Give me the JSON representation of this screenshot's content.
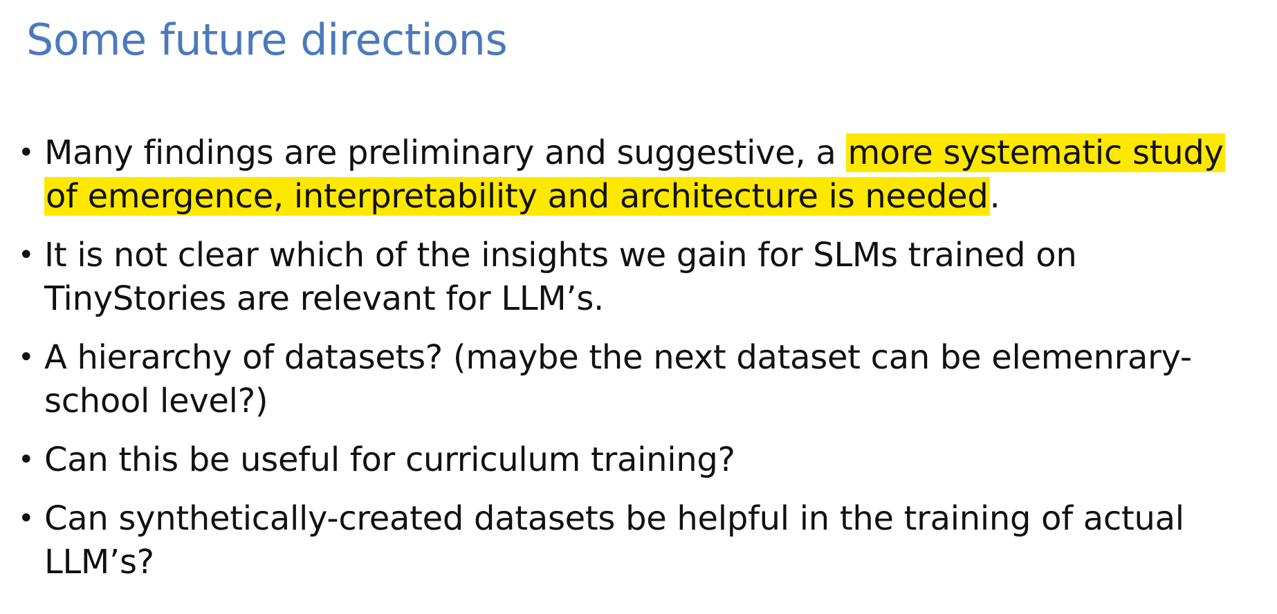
{
  "slide": {
    "title": "Some future directions",
    "highlight_color": "#ffe800",
    "title_color": "#4b79bf",
    "bullet_glyph": "•",
    "bullets": [
      {
        "pre": "Many findings are preliminary and suggestive, a ",
        "highlight": "more systematic study of emergence, interpretability and architecture is needed",
        "post": "."
      },
      {
        "pre": "It is not clear which of the insights we gain for SLMs trained on TinyStories are relevant for LLM’s.",
        "highlight": "",
        "post": ""
      },
      {
        "pre": "A hierarchy of datasets? (maybe the next dataset can be elemenrary-school level?)",
        "highlight": "",
        "post": ""
      },
      {
        "pre": "Can this be useful for curriculum training?",
        "highlight": "",
        "post": ""
      },
      {
        "pre": "Can synthetically-created datasets be helpful in the training of actual LLM’s?",
        "highlight": "",
        "post": ""
      }
    ]
  }
}
